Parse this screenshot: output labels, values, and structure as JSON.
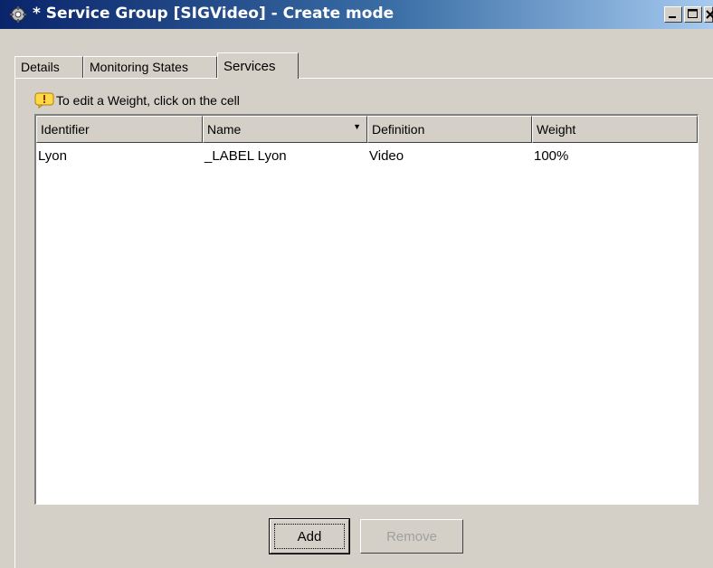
{
  "window": {
    "title": "* Service Group [SIGVideo] - Create mode",
    "app_icon": "service-group-icon",
    "controls": [
      "minimize",
      "maximize",
      "close"
    ]
  },
  "tabs": [
    {
      "label": "Details",
      "active": false
    },
    {
      "label": "Monitoring States",
      "active": false
    },
    {
      "label": "Services",
      "active": true
    }
  ],
  "hint": {
    "icon": "info-bulb-icon",
    "text": "To edit a Weight, click on the cell"
  },
  "table": {
    "columns": [
      {
        "label": "Identifier"
      },
      {
        "label": "Name",
        "sorted": true
      },
      {
        "label": "Definition"
      },
      {
        "label": "Weight"
      }
    ],
    "rows": [
      {
        "identifier": "Lyon",
        "name": "_LABEL Lyon",
        "definition": "Video",
        "weight": "100%"
      }
    ]
  },
  "buttons": {
    "add": "Add",
    "remove": "Remove"
  },
  "colors": {
    "title_start": "#0a246a",
    "title_end": "#a6caf0",
    "face": "#d4d0c8"
  }
}
